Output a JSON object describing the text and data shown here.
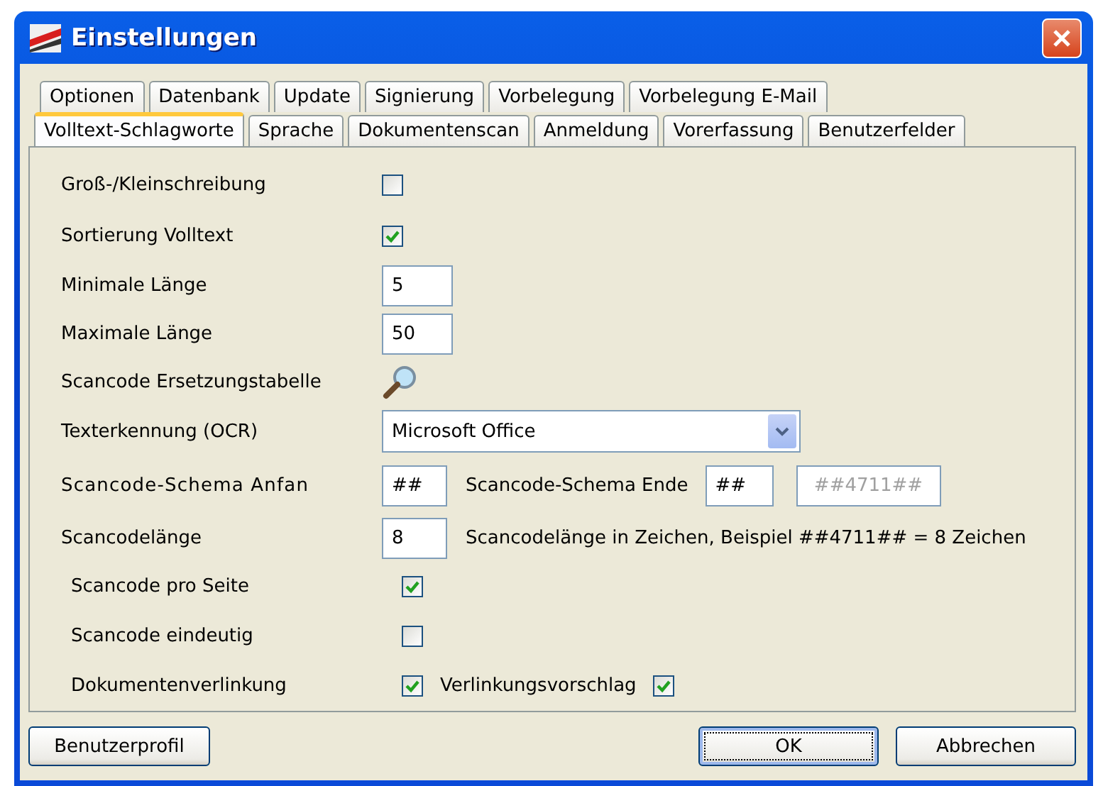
{
  "window": {
    "title": "Einstellungen"
  },
  "tab_rows": [
    [
      {
        "label": "Optionen",
        "selected": false
      },
      {
        "label": "Datenbank",
        "selected": false
      },
      {
        "label": "Update",
        "selected": false
      },
      {
        "label": "Signierung",
        "selected": false
      },
      {
        "label": "Vorbelegung",
        "selected": false
      },
      {
        "label": "Vorbelegung E-Mail",
        "selected": false
      }
    ],
    [
      {
        "label": "Volltext-Schlagworte",
        "selected": true
      },
      {
        "label": "Sprache",
        "selected": false
      },
      {
        "label": "Dokumentenscan",
        "selected": false
      },
      {
        "label": "Anmeldung",
        "selected": false
      },
      {
        "label": "Vorerfassung",
        "selected": false
      },
      {
        "label": "Benutzerfelder",
        "selected": false
      }
    ]
  ],
  "settings": [
    {
      "kind": "checkbox",
      "label": "Groß-/Kleinschreibung",
      "checked": false
    },
    {
      "kind": "checkbox",
      "label": "Sortierung Volltext",
      "checked": true
    },
    {
      "kind": "text",
      "label": "Minimale Länge",
      "value": "5"
    },
    {
      "kind": "text",
      "label": "Maximale Länge",
      "value": "50"
    },
    {
      "kind": "lookup",
      "label": "Scancode Ersetzungstabelle"
    },
    {
      "kind": "select",
      "label": "Texterkennung (OCR)",
      "value": "Microsoft Office"
    },
    {
      "kind": "schema",
      "label": "Scancode-Schema Anfan",
      "value": "##",
      "end_label": "Scancode-Schema Ende",
      "end_value": "##",
      "preview": "##4711##",
      "preview_disabled": true
    },
    {
      "kind": "hint",
      "label": "Scancodelänge",
      "value": "8",
      "hint": "Scancodelänge in Zeichen, Beispiel ##4711## = 8 Zeichen"
    },
    {
      "kind": "checkbox",
      "label": "Scancode pro Seite",
      "checked": true
    },
    {
      "kind": "checkbox",
      "label": "Scancode eindeutig",
      "checked": false
    },
    {
      "kind": "checkbox-pair",
      "label": "Dokumentenverlinkung",
      "checked": true,
      "second_label": "Verlinkungsvorschlag",
      "second_checked": true
    }
  ],
  "buttons": {
    "left": "Benutzerprofil",
    "ok": "OK",
    "cancel": "Abbrechen"
  }
}
